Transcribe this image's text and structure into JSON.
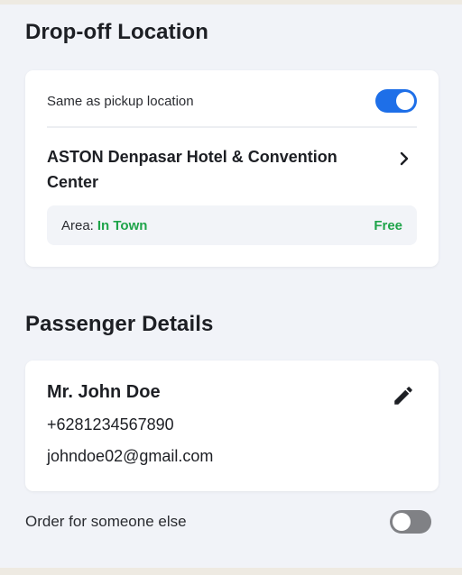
{
  "dropoff": {
    "title": "Drop-off Location",
    "same_as_pickup_label": "Same as pickup location",
    "same_as_pickup_enabled": true,
    "hotel_name": "ASTON Denpasar Hotel & Convention Center",
    "area_label": "Area:",
    "area_value": "In Town",
    "area_price": "Free"
  },
  "passenger": {
    "title": "Passenger Details",
    "name": "Mr. John Doe",
    "phone": "+6281234567890",
    "email": "johndoe02@gmail.com"
  },
  "order_for_someone_else": {
    "label": "Order for someone else",
    "enabled": false
  },
  "colors": {
    "accent": "#1e6fe8",
    "success": "#1fa44a",
    "background": "#f1f3f8",
    "toggle_off": "#808185"
  },
  "icons": {
    "chevron": "chevron-right-icon",
    "edit": "pencil-edit-icon"
  }
}
